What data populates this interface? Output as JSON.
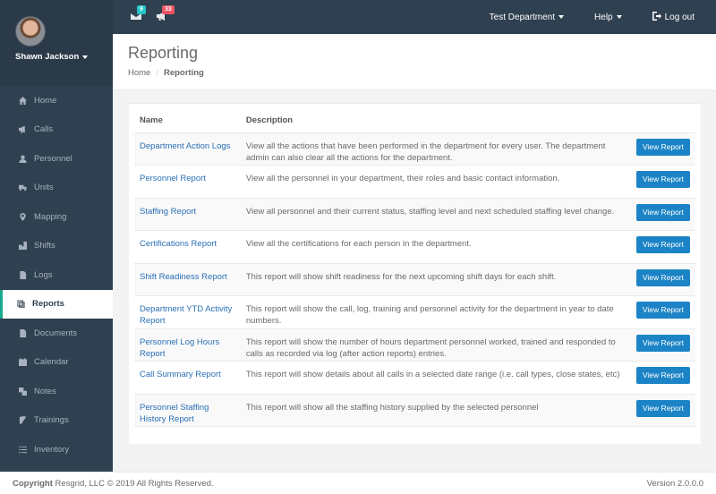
{
  "user": {
    "name": "Shawn Jackson"
  },
  "nav": [
    {
      "label": "Home",
      "icon": "home-icon"
    },
    {
      "label": "Calls",
      "icon": "megaphone-icon"
    },
    {
      "label": "Personnel",
      "icon": "user-icon"
    },
    {
      "label": "Units",
      "icon": "truck-icon"
    },
    {
      "label": "Mapping",
      "icon": "map-marker-icon"
    },
    {
      "label": "Shifts",
      "icon": "shifts-icon"
    },
    {
      "label": "Logs",
      "icon": "file-icon"
    },
    {
      "label": "Reports",
      "icon": "reports-icon",
      "active": true
    },
    {
      "label": "Documents",
      "icon": "documents-icon"
    },
    {
      "label": "Calendar",
      "icon": "calendar-icon"
    },
    {
      "label": "Notes",
      "icon": "notes-icon"
    },
    {
      "label": "Trainings",
      "icon": "book-icon"
    },
    {
      "label": "Inventory",
      "icon": "inventory-icon"
    }
  ],
  "topbar": {
    "messages_count": "9",
    "calls_count": "33",
    "department": "Test Department",
    "help": "Help",
    "logout": "Log out"
  },
  "heading": {
    "title": "Reporting",
    "breadcrumb": [
      "Home",
      "Reporting"
    ]
  },
  "table": {
    "headers": [
      "Name",
      "Description",
      ""
    ],
    "button_label": "View Report",
    "rows": [
      {
        "name": "Department Action Logs",
        "desc": "View all the actions that have been performed in the department for every user. The department admin can also clear all the actions for the department."
      },
      {
        "name": "Personnel Report",
        "desc": "View all the personnel in your department, their roles and basic contact information."
      },
      {
        "name": "Staffing Report",
        "desc": "View all personnel and their current status, staffing level and next scheduled staffing level change."
      },
      {
        "name": "Certifications Report",
        "desc": "View all the certifications for each person in the department."
      },
      {
        "name": "Shift Readiness Report",
        "desc": "This report will show shift readiness for the next upcoming shift days for each shift."
      },
      {
        "name": "Department YTD Activity Report",
        "desc": "This report will show the call, log, training and personnel activity for the department in year to date numbers."
      },
      {
        "name": "Personnel Log Hours Report",
        "desc": "This report will show the number of hours department personnel worked, trained and responded to calls as recorded via log (after action reports) entries."
      },
      {
        "name": "Call Summary Report",
        "desc": "This report will show details about all calls in a selected date range (i.e. call types, close states, etc)"
      },
      {
        "name": "Personnel Staffing History Report",
        "desc": "This report will show all the staffing history supplied by the selected personnel"
      }
    ]
  },
  "footer": {
    "copyright_bold": "Copyright",
    "copyright_text": "Resgrid, LLC © 2019 All Rights Reserved.",
    "version": "Version 2.0.0.0"
  },
  "colors": {
    "sidebar": "#2f4050",
    "link": "#2a6fb5",
    "button": "#1c84c6",
    "accent": "#19aa8d"
  }
}
